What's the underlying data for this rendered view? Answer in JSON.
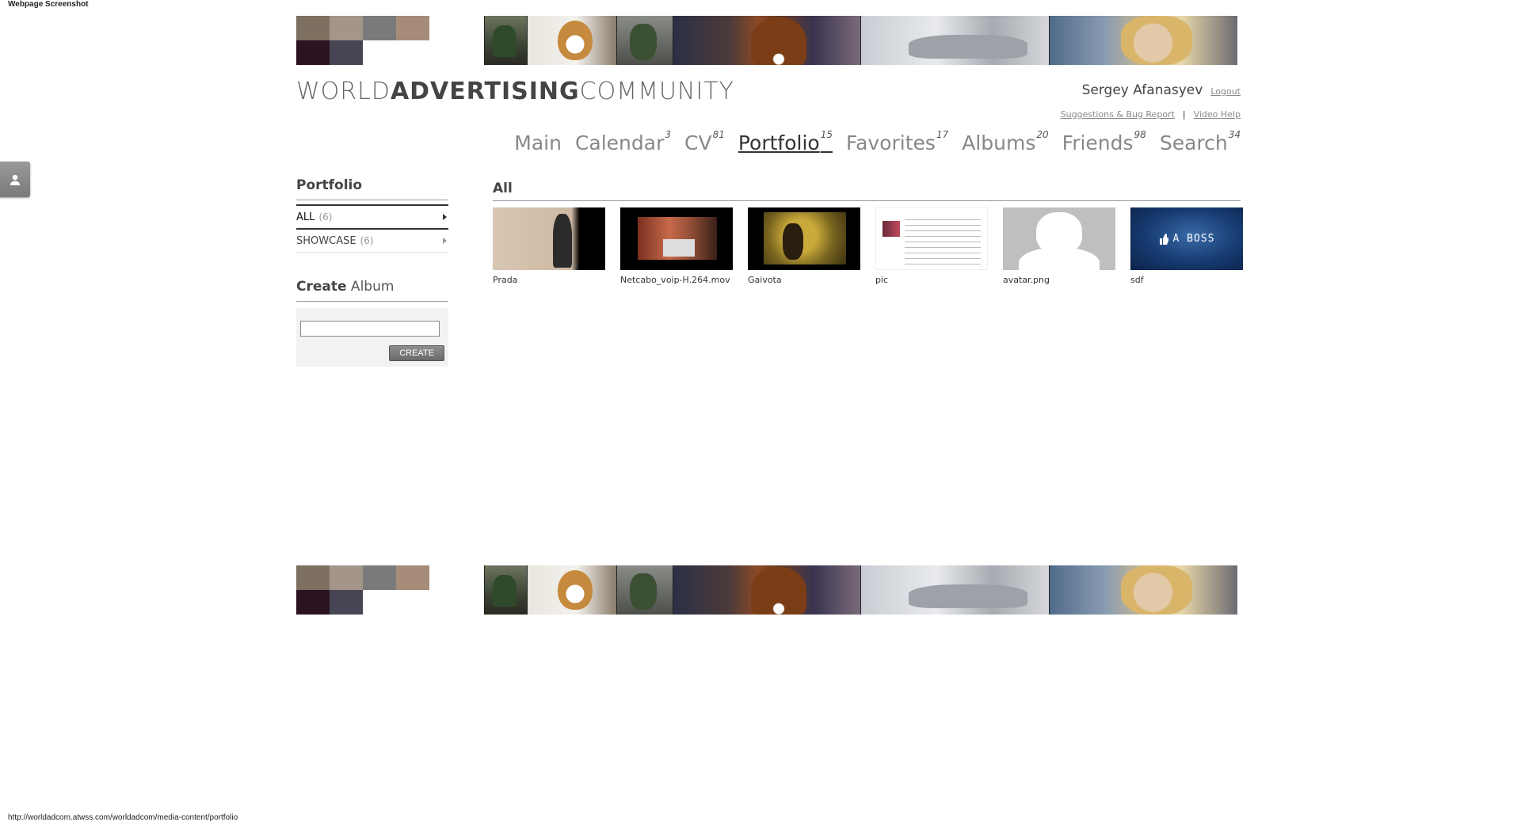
{
  "page": {
    "caption": "Webpage Screenshot",
    "status_url": "http://worldadcom.atwss.com/worldadcom/media-content/portfolio"
  },
  "brand": {
    "part1": "WORLD",
    "part2": "ADVERTISING",
    "part3": "COMMUNITY"
  },
  "banner": {
    "swatches": [
      "#7d7060",
      "#a39689",
      "#7b7a7a",
      "#a58b78",
      "#ffffff",
      "#2c1320",
      "#454554",
      "#ffffff",
      "#ffffff",
      "#ffffff"
    ]
  },
  "user": {
    "name": "Sergey Afanasyev",
    "logout": "Logout"
  },
  "help": {
    "suggestions": "Suggestions & Bug Report",
    "separator": "|",
    "video": "Video Help"
  },
  "nav": [
    {
      "label": "Main",
      "count": ""
    },
    {
      "label": "Calendar",
      "count": "3"
    },
    {
      "label": "CV",
      "count": "81"
    },
    {
      "label": "Portfolio",
      "count": "15"
    },
    {
      "label": "Favorites",
      "count": "17"
    },
    {
      "label": "Albums",
      "count": "20"
    },
    {
      "label": "Friends",
      "count": "98"
    },
    {
      "label": "Search",
      "count": "34"
    }
  ],
  "sidebar": {
    "title": "Portfolio",
    "items": [
      {
        "label": "ALL",
        "count": "(6)"
      },
      {
        "label": "SHOWCASE",
        "count": "(6)"
      }
    ],
    "create": {
      "title_bold": "Create",
      "title_rest": " Album",
      "input_value": "",
      "button": "CREATE"
    }
  },
  "main": {
    "title": "All",
    "items": [
      {
        "caption": "Prada"
      },
      {
        "caption": "Netcabo_voip-H.264.mov"
      },
      {
        "caption": "Gaivota"
      },
      {
        "caption": "pic"
      },
      {
        "caption": "avatar.png"
      },
      {
        "caption": "sdf",
        "thumb_text": "A BOSS"
      }
    ]
  },
  "icons": {
    "side_tab": "user-icon",
    "thumb_like": "thumbs-up-icon"
  }
}
